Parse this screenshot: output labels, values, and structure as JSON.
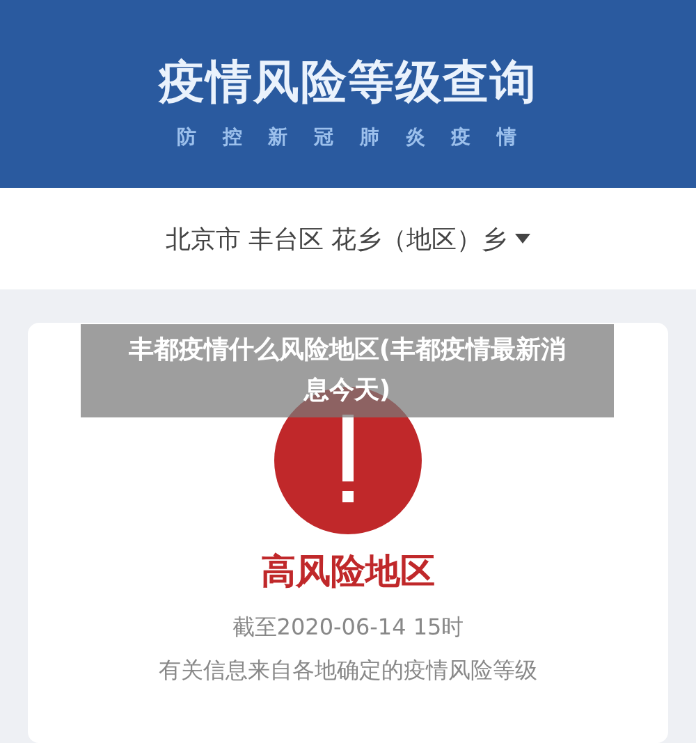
{
  "header": {
    "title": "疫情风险等级查询",
    "subtitle": "防 控 新 冠 肺 炎 疫 情"
  },
  "location_selector": {
    "value": "北京市 丰台区 花乡（地区）乡"
  },
  "result_card": {
    "level_label": "高风险地区",
    "as_of": "截至2020-06-14 15时",
    "note": "有关信息来自各地确定的疫情风险等级"
  },
  "overlay_caption": "丰都疫情什么风险地区(丰都疫情最新消息今天)"
}
